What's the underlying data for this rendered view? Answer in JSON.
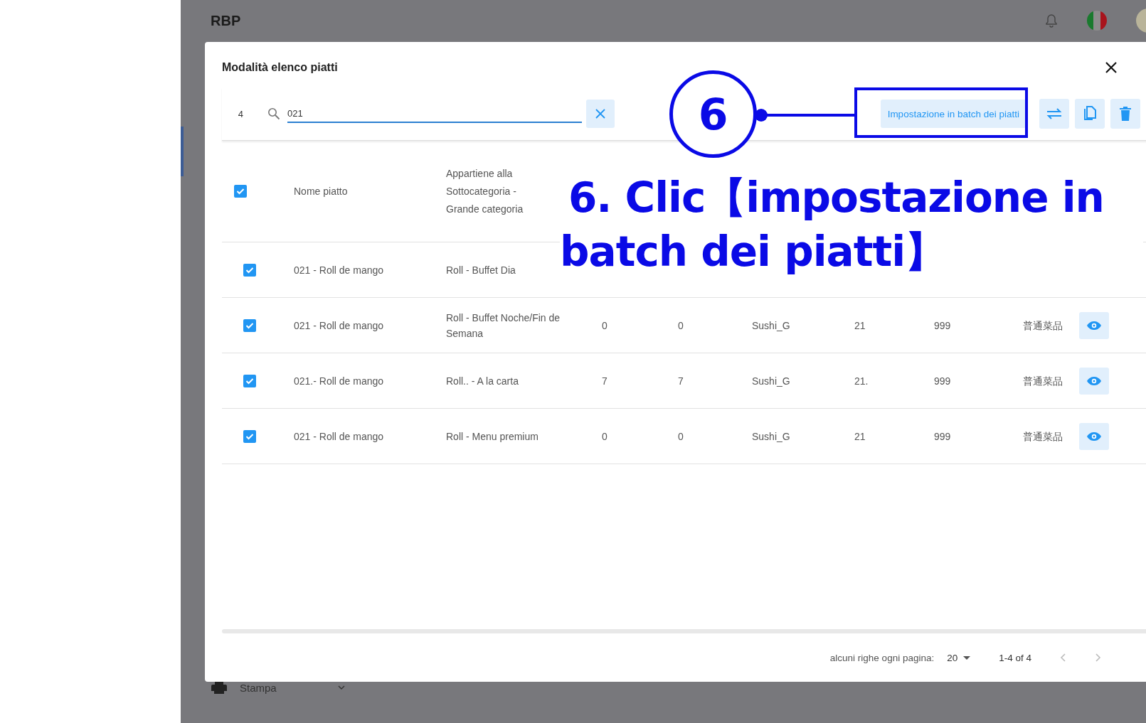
{
  "app_bar": {
    "title": "RBP"
  },
  "sidebar": {
    "items": [
      {
        "label": "Stampa"
      }
    ]
  },
  "dialog": {
    "title": "Modalità elenco piatti",
    "selected_count": "4",
    "search": {
      "value": "021"
    },
    "toolbar": {
      "batch_button": "Impostazione in batch dei piatti"
    },
    "table": {
      "header_checked": true,
      "columns": [
        "Nome piatto",
        "Appartiene alla Sottocategoria - Grande categoria"
      ],
      "rows": [
        {
          "checked": true,
          "cells": [
            "021 - Roll de mango",
            "Roll - Buffet Dia"
          ]
        },
        {
          "checked": true,
          "cells": [
            "021 - Roll de mango",
            "Roll - Buffet Noche/Fin de Semana",
            "0",
            "0",
            "Sushi_G",
            "21",
            "999",
            "普通菜品"
          ]
        },
        {
          "checked": true,
          "cells": [
            "021.- Roll de mango",
            "Roll.. - A la carta",
            "7",
            "7",
            "Sushi_G",
            "21.",
            "999",
            "普通菜品"
          ]
        },
        {
          "checked": true,
          "cells": [
            "021 - Roll de mango",
            "Roll - Menu premium",
            "0",
            "0",
            "Sushi_G",
            "21",
            "999",
            "普通菜品"
          ]
        }
      ]
    },
    "pagination": {
      "rows_per_page_label": "alcuni righe ogni pagina:",
      "rows_per_page": "20",
      "range": "1-4 of 4"
    }
  },
  "annotation": {
    "step": "6",
    "caption_lines": [
      "6. Clic【impostazione in",
      "batch dei piatti】"
    ]
  }
}
